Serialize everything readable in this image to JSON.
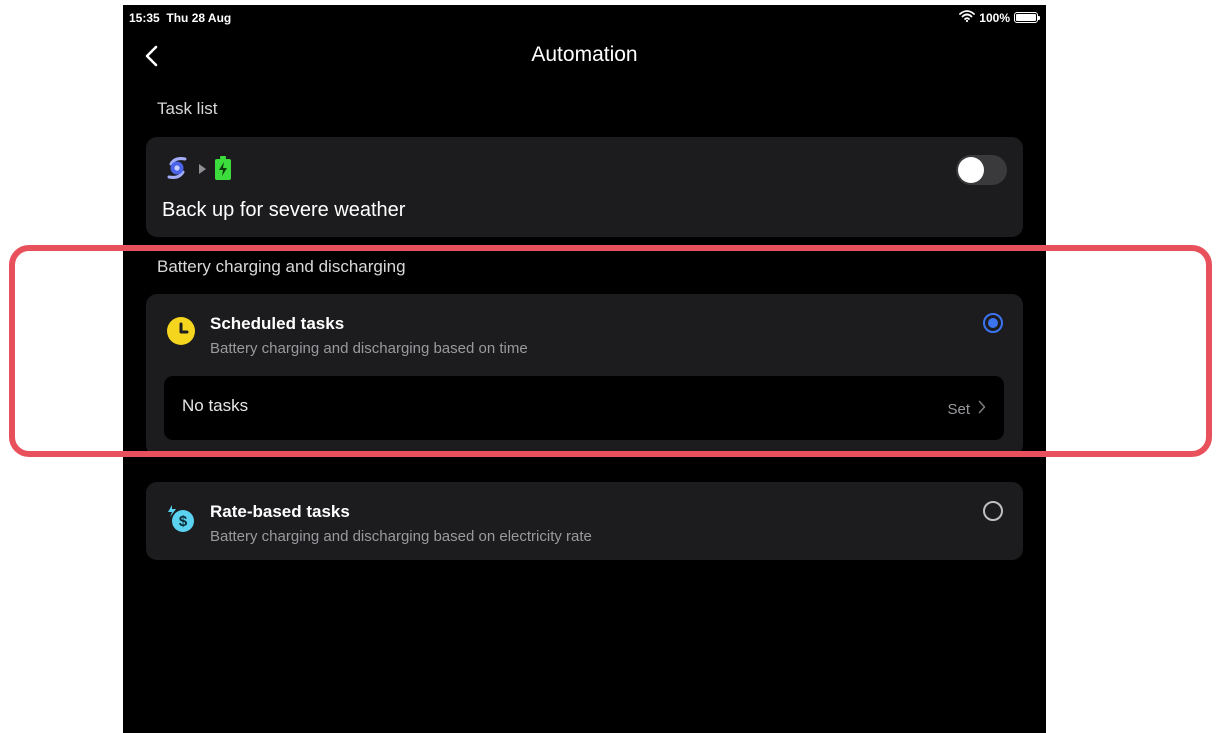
{
  "status_bar": {
    "time": "15:35",
    "date": "Thu 28 Aug",
    "battery_percent": "100%",
    "icons": [
      "wifi-icon",
      "battery-icon"
    ]
  },
  "header": {
    "title": "Automation",
    "back_icon": "chevron-left-icon"
  },
  "sections": {
    "task_list_label": "Task list",
    "battery_label": "Battery charging and discharging"
  },
  "weather_task": {
    "title": "Back up for severe weather",
    "icons": [
      "hurricane-icon",
      "play-arrow-icon",
      "battery-charging-icon"
    ],
    "enabled": false
  },
  "scheduled_task": {
    "title": "Scheduled tasks",
    "description": "Battery charging and discharging based on time",
    "icon": "clock-icon",
    "selected": true,
    "empty_label": "No tasks",
    "action_label": "Set"
  },
  "rate_task": {
    "title": "Rate-based tasks",
    "description": "Battery charging and discharging based on electricity rate",
    "icon": "dollar-rate-icon",
    "selected": false
  },
  "colors": {
    "background": "#000000",
    "card": "#1c1c1e",
    "accent_blue": "#3b73f0",
    "highlight_red": "#e8505b",
    "clock_yellow": "#f5d51e",
    "battery_green": "#3ddc3d",
    "rate_cyan": "#5ad2f0"
  }
}
